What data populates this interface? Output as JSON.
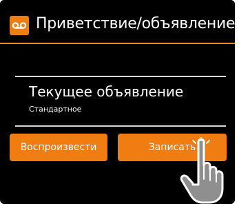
{
  "header": {
    "icon": "voicemail-icon",
    "title": "Приветствие/объявление"
  },
  "item": {
    "title": "Текущее объявление",
    "subtitle": "Стандартное"
  },
  "buttons": {
    "play_label": "Воспроизвести",
    "record_label": "Записать"
  },
  "colors": {
    "accent": "#f07d12",
    "background": "#000000",
    "text": "#ffffff"
  }
}
